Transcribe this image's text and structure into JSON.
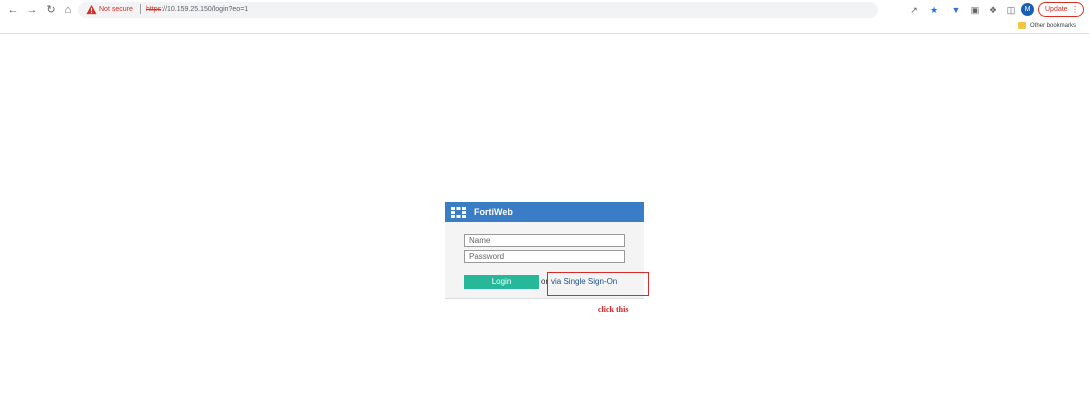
{
  "browser": {
    "security_label": "Not secure",
    "url_https": "https",
    "url_rest": "://10.159.25.150/login?eo=1",
    "update_label": "Update",
    "avatar_initial": "M",
    "bookmarks_label": "Other bookmarks",
    "icons": [
      "back-arrow-icon",
      "forward-arrow-icon",
      "reload-icon",
      "home-icon",
      "warning-icon",
      "share-icon",
      "star-icon",
      "extension-icons",
      "puzzle-icon",
      "sidebar-icon",
      "menu-dots-icon"
    ]
  },
  "login": {
    "app_title": "FortiWeb",
    "name_placeholder": "Name",
    "password_placeholder": "Password",
    "login_label": "Login",
    "or_text": "or",
    "sso_label": "via Single Sign-On"
  },
  "annotation": {
    "text": "click this",
    "color": "#d92b2b"
  },
  "colors": {
    "header": "#3a7cc5",
    "login_button": "#27b89a"
  }
}
